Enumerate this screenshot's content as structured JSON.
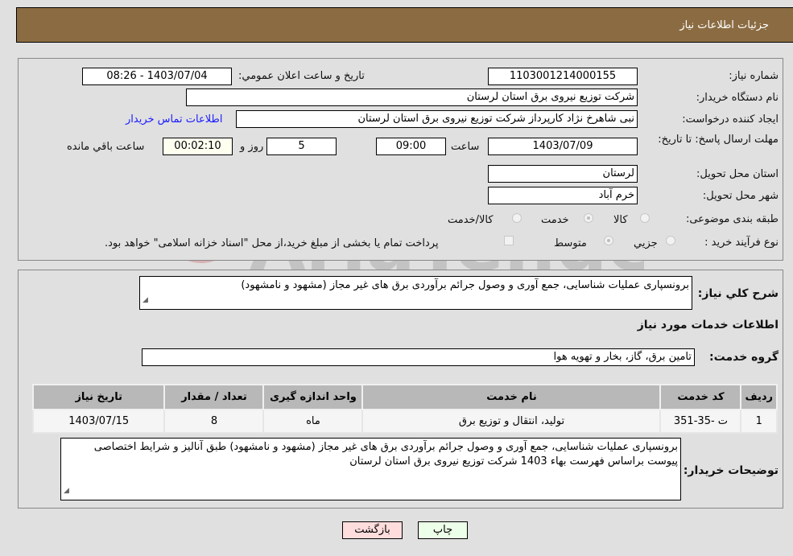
{
  "header": {
    "title": "جزئیات اطلاعات نیاز"
  },
  "details": {
    "need_number_label": "شماره نیاز:",
    "need_number": "1103001214000155",
    "announce_label": "تاریخ و ساعت اعلان عمومي:",
    "announce_value": "1403/07/04 - 08:26",
    "buyer_org_label": "نام دستگاه خریدار:",
    "buyer_org": "شرکت توزیع نیروی برق استان لرستان",
    "creator_label": "ایجاد کننده درخواست:",
    "creator": "نبی شاهرخ نژاد کارپرداز شرکت توزیع نیروی برق استان لرستان",
    "contact_link": "اطلاعات تماس خریدار",
    "deadline_label": "مهلت ارسال پاسخ: تا تاریخ:",
    "deadline_date": "1403/07/09",
    "time_label": "ساعت",
    "deadline_time": "09:00",
    "days_value": "5",
    "days_label": "روز و",
    "remaining_time": "00:02:10",
    "remaining_label": "ساعت باقي مانده",
    "province_label": "استان محل تحویل:",
    "province": "لرستان",
    "city_label": "شهر محل تحویل:",
    "city": "خرم آباد",
    "category_label": "طبقه بندی موضوعی:",
    "category_options": [
      "کالا",
      "خدمت",
      "کالا/خدمت"
    ],
    "category_selected": "خدمت",
    "process_label": "نوع فرآیند خرید :",
    "process_options": [
      "جزيي",
      "متوسط"
    ],
    "process_selected": "متوسط",
    "treasury_note": "پرداخت تمام یا بخشی از مبلغ خرید،از محل \"اسناد خزانه اسلامی\" خواهد بود."
  },
  "description": {
    "label": "شرح کلي نیاز:",
    "value": "برونسپاری عملیات شناسایی، جمع آوری و وصول جرائم برآوردی برق های غیر مجاز (مشهود و نامشهود)"
  },
  "services": {
    "section_title": "اطلاعات خدمات مورد نیاز",
    "group_label": "گروه خدمت:",
    "group_value": "تامین برق، گاز، بخار و تهویه هوا",
    "table": {
      "headers": [
        "ردیف",
        "کد خدمت",
        "نام خدمت",
        "واحد اندازه گیری",
        "تعداد / مقدار",
        "تاریخ نیاز"
      ],
      "rows": [
        [
          "1",
          "ت -35-351",
          "تولید، انتقال و توزیع برق",
          "ماه",
          "8",
          "1403/07/15"
        ]
      ]
    }
  },
  "buyer_notes": {
    "label": "توضیحات خریدار:",
    "value": "برونسپاری عملیات شناسایی، جمع آوری و وصول جرائم برآوردی برق های غیر مجاز (مشهود و نامشهود) طبق آنالیز  و شرایط اختصاصی پیوست براساس فهرست بهاء 1403 شرکت توزیع نیروی برق استان لرستان"
  },
  "buttons": {
    "print": "چاپ",
    "back": "بازگشت"
  },
  "watermark": {
    "text": "AriaTender.neT"
  },
  "colors": {
    "header_bg": "#8b6c42",
    "link": "#1a1aff",
    "back_btn": "#ffdddd",
    "print_btn": "#ecffe8"
  }
}
